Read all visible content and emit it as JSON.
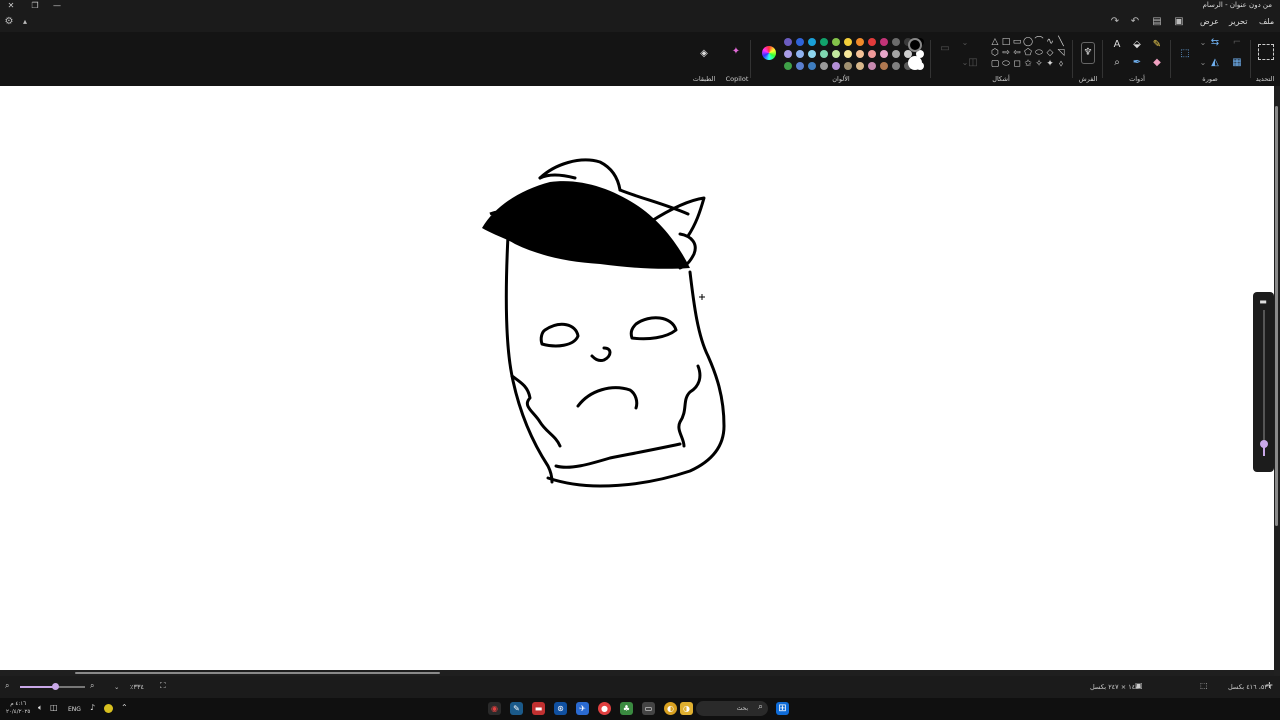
{
  "window": {
    "title": "من دون عنوان - الرسام",
    "controls": [
      "close-icon",
      "maximize-icon",
      "minimize-icon"
    ]
  },
  "menu": {
    "file": "ملف",
    "edit": "تحرير",
    "view": "عرض"
  },
  "ribbon": {
    "groups": {
      "selection": "التحديد",
      "image": "صورة",
      "tools": "أدوات",
      "brushes": "الفرش",
      "shapes": "أشكال",
      "colors": "الألوان",
      "copilot": "Copilot",
      "layers": "الطبقات"
    },
    "palette_colors": [
      [
        "#6b5cc0",
        "#2f63d8",
        "#1aa0d8",
        "#11a26b",
        "#83c34a",
        "#f4cf3a",
        "#f08a2a",
        "#e23b3b",
        "#c23377",
        "#6b6b6b",
        "#3a3a3a",
        "#000000"
      ],
      [
        "#a99ce6",
        "#8fb2f0",
        "#8ed6ef",
        "#7fd7b0",
        "#c3e89e",
        "#f7e79a",
        "#f5c297",
        "#f09a9a",
        "#e7a6c9",
        "#a4a4a4",
        "#cfcfcf",
        "#ffffff"
      ],
      [
        "#3fa048",
        "#5b7fcf",
        "#3f7ec0",
        "#9b9b9b",
        "#b48fd6",
        "#a09070",
        "#d8b78a",
        "#c88ab0",
        "#b07850",
        "#808080",
        "#5a5a5a",
        "#ffffff"
      ]
    ],
    "primary_color": "#000000",
    "secondary_color": "#ffffff"
  },
  "status": {
    "canvas_size": "١٤٨٠ × ٢٤٧ بكسل",
    "position": "٥٣٦، ٤١٦ بكسل",
    "zoom": "٪٣٣٤",
    "zoom_level": 0.55
  },
  "side_panel": {
    "brush_size_level": 0.08
  },
  "taskbar": {
    "search_placeholder": "بحث",
    "language": "ENG",
    "time": "٤:١٦ م",
    "date": "٢٠/٤/٢٠٢٥"
  }
}
